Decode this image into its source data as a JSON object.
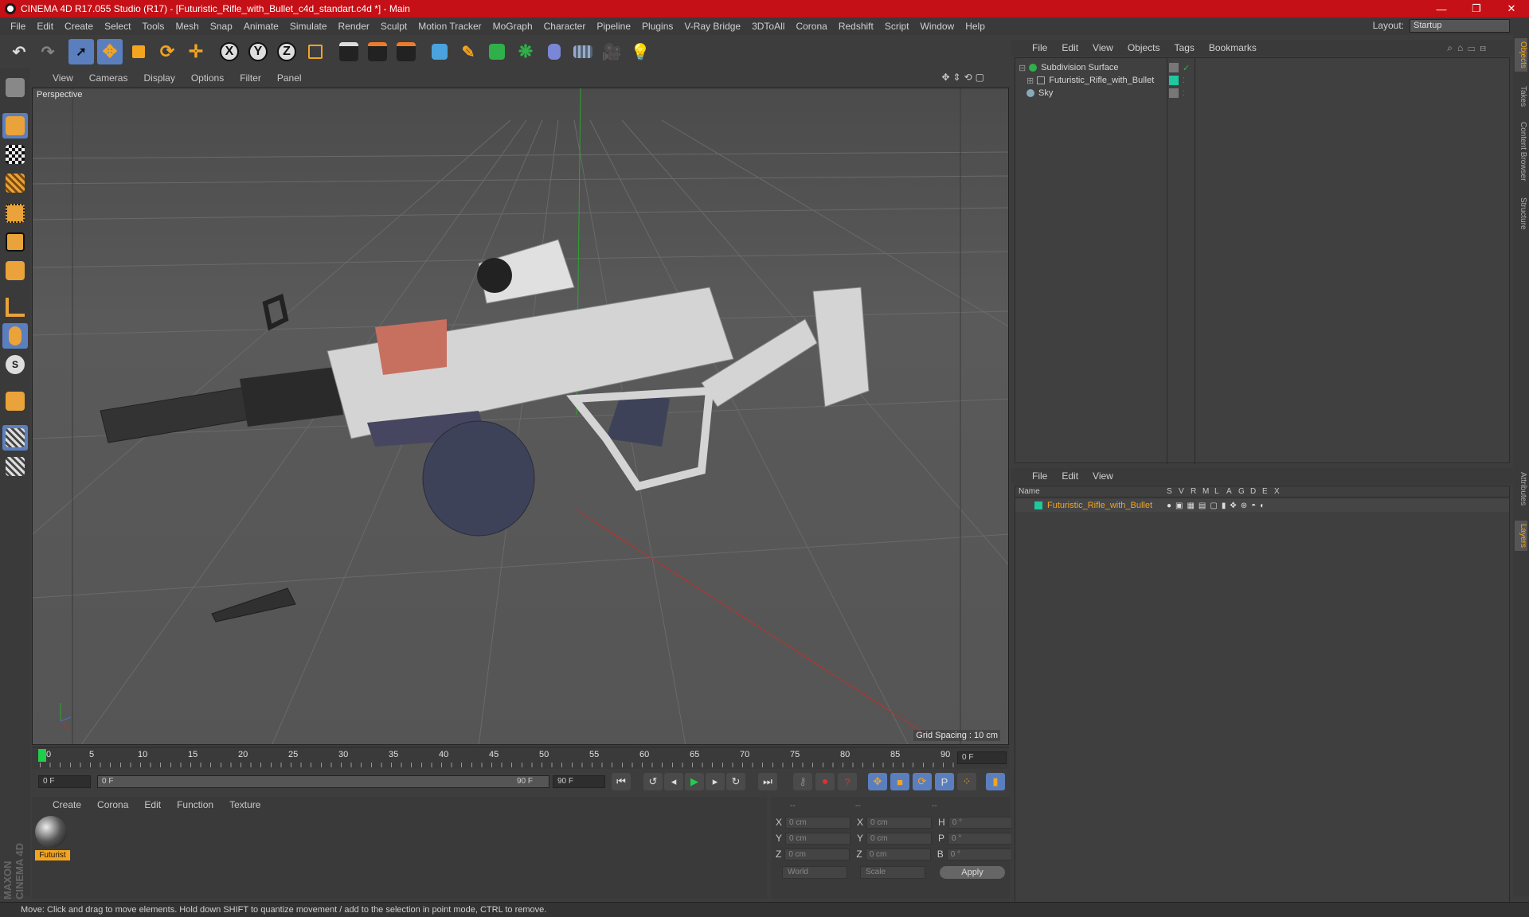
{
  "window": {
    "title": "CINEMA 4D R17.055 Studio (R17) - [Futuristic_Rifle_with_Bullet_c4d_standart.c4d *] - Main",
    "controls": [
      "—",
      "❐",
      "✕"
    ]
  },
  "menubar": {
    "items": [
      "File",
      "Edit",
      "Create",
      "Select",
      "Tools",
      "Mesh",
      "Snap",
      "Animate",
      "Simulate",
      "Render",
      "Sculpt",
      "Motion Tracker",
      "MoGraph",
      "Character",
      "Pipeline",
      "Plugins",
      "V-Ray Bridge",
      "3DToAll",
      "Corona",
      "Redshift",
      "Script",
      "Window",
      "Help"
    ],
    "layout_label": "Layout:",
    "layout_value": "Startup"
  },
  "toolbar": {
    "axis_x": "X",
    "axis_y": "Y",
    "axis_z": "Z"
  },
  "viewport": {
    "menu": [
      "View",
      "Cameras",
      "Display",
      "Options",
      "Filter",
      "Panel"
    ],
    "label": "Perspective",
    "grid_spacing": "Grid Spacing : 10 cm"
  },
  "timeline": {
    "ticks": [
      "0",
      "5",
      "10",
      "15",
      "20",
      "25",
      "30",
      "35",
      "40",
      "45",
      "50",
      "55",
      "60",
      "65",
      "70",
      "75",
      "80",
      "85",
      "90"
    ],
    "current_frame": "0 F",
    "start_field": "0 F",
    "range_start": "0 F",
    "range_end": "90 F",
    "end_field": "90 F"
  },
  "material_manager": {
    "menu": [
      "Create",
      "Corona",
      "Edit",
      "Function",
      "Texture"
    ],
    "material_name": "Futurist"
  },
  "coordinates": {
    "header": [
      "--",
      "--",
      "--"
    ],
    "rows": [
      {
        "a": "X",
        "av": "0 cm",
        "b": "X",
        "bv": "0 cm",
        "c": "H",
        "cv": "0 °"
      },
      {
        "a": "Y",
        "av": "0 cm",
        "b": "Y",
        "bv": "0 cm",
        "c": "P",
        "cv": "0 °"
      },
      {
        "a": "Z",
        "av": "0 cm",
        "b": "Z",
        "bv": "0 cm",
        "c": "B",
        "cv": "0 °"
      }
    ],
    "mode1": "World",
    "mode2": "Scale",
    "apply": "Apply"
  },
  "object_manager": {
    "menu": [
      "File",
      "Edit",
      "View",
      "Objects",
      "Tags",
      "Bookmarks"
    ],
    "objects": [
      {
        "name": "Subdivision Surface"
      },
      {
        "name": "Futuristic_Rifle_with_Bullet"
      },
      {
        "name": "Sky"
      }
    ]
  },
  "layer_manager": {
    "menu": [
      "File",
      "Edit",
      "View"
    ],
    "col_name": "Name",
    "cols": [
      "S",
      "V",
      "R",
      "M",
      "L",
      "A",
      "G",
      "D",
      "E",
      "X"
    ],
    "layer_name": "Futuristic_Rifle_with_Bullet",
    "layer_color": "#1ec8a0"
  },
  "side_tabs": [
    "Objects",
    "Takes",
    "Content Browser",
    "Structure",
    "Attributes",
    "Layers"
  ],
  "status": "Move: Click and drag to move elements. Hold down SHIFT to quantize movement / add to the selection in point mode, CTRL to remove.",
  "brand": "MAXON CINEMA 4D"
}
